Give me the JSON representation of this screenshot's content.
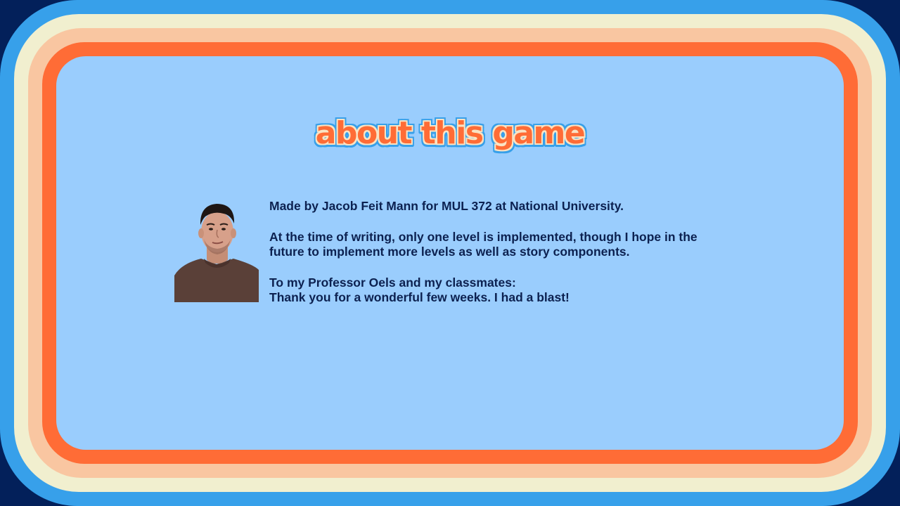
{
  "title": "about this game",
  "author_photo_alt": "Photo of Jacob Feit Mann",
  "paragraphs": {
    "credit": "Made by Jacob Feit Mann for MUL 372 at National University.",
    "status_line1": "At the time of writing, only one level is implemented, though I hope in the",
    "status_line2": "future to implement more levels as well as story components.",
    "thanks_line1": "To my Professor Oels and my classmates:",
    "thanks_line2": "Thank you for a wonderful few weeks. I had a blast!"
  },
  "colors": {
    "outer_background": "#03205a",
    "frame_blue": "#37a0ea",
    "frame_cream": "#f1efcf",
    "frame_peach": "#f9c6a1",
    "frame_orange": "#ff6c36",
    "panel": "#9acdfd",
    "text": "#0c2150"
  }
}
